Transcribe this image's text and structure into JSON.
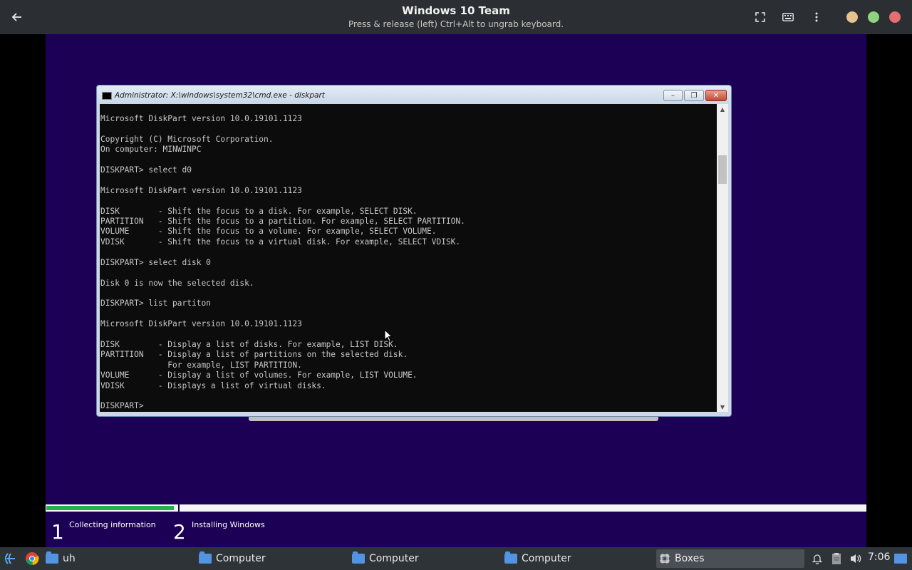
{
  "header": {
    "title": "Windows 10 Team",
    "subtitle": "Press & release (left) Ctrl+Alt to ungrab keyboard.",
    "back_icon": "arrow-left-icon",
    "window_controls_colors": [
      "#e7c48f",
      "#8fd37f",
      "#e36f6f"
    ]
  },
  "cmd": {
    "title": "Administrator: X:\\windows\\system32\\cmd.exe - diskpart",
    "lines": [
      "Microsoft DiskPart version 10.0.19101.1123",
      "",
      "Copyright (C) Microsoft Corporation.",
      "On computer: MINWINPC",
      "",
      "DISKPART> select d0",
      "",
      "Microsoft DiskPart version 10.0.19101.1123",
      "",
      "DISK        - Shift the focus to a disk. For example, SELECT DISK.",
      "PARTITION   - Shift the focus to a partition. For example, SELECT PARTITION.",
      "VOLUME      - Shift the focus to a volume. For example, SELECT VOLUME.",
      "VDISK       - Shift the focus to a virtual disk. For example, SELECT VDISK.",
      "",
      "DISKPART> select disk 0",
      "",
      "Disk 0 is now the selected disk.",
      "",
      "DISKPART> list partiton",
      "",
      "Microsoft DiskPart version 10.0.19101.1123",
      "",
      "DISK        - Display a list of disks. For example, LIST DISK.",
      "PARTITION   - Display a list of partitions on the selected disk.",
      "              For example, LIST PARTITION.",
      "VOLUME      - Display a list of volumes. For example, LIST VOLUME.",
      "VDISK       - Displays a list of virtual disks.",
      "",
      "DISKPART> "
    ]
  },
  "setup": {
    "progress_fraction": 0.155,
    "progress_color": "#22b14c",
    "steps": [
      {
        "number": "1",
        "label": "Collecting information"
      },
      {
        "number": "2",
        "label": "Installing Windows"
      }
    ]
  },
  "taskbar": {
    "tasks": [
      {
        "label": "uh"
      },
      {
        "label": "Computer"
      },
      {
        "label": "Computer"
      },
      {
        "label": "Computer"
      },
      {
        "label": "Boxes"
      }
    ],
    "clock": "7:06"
  }
}
